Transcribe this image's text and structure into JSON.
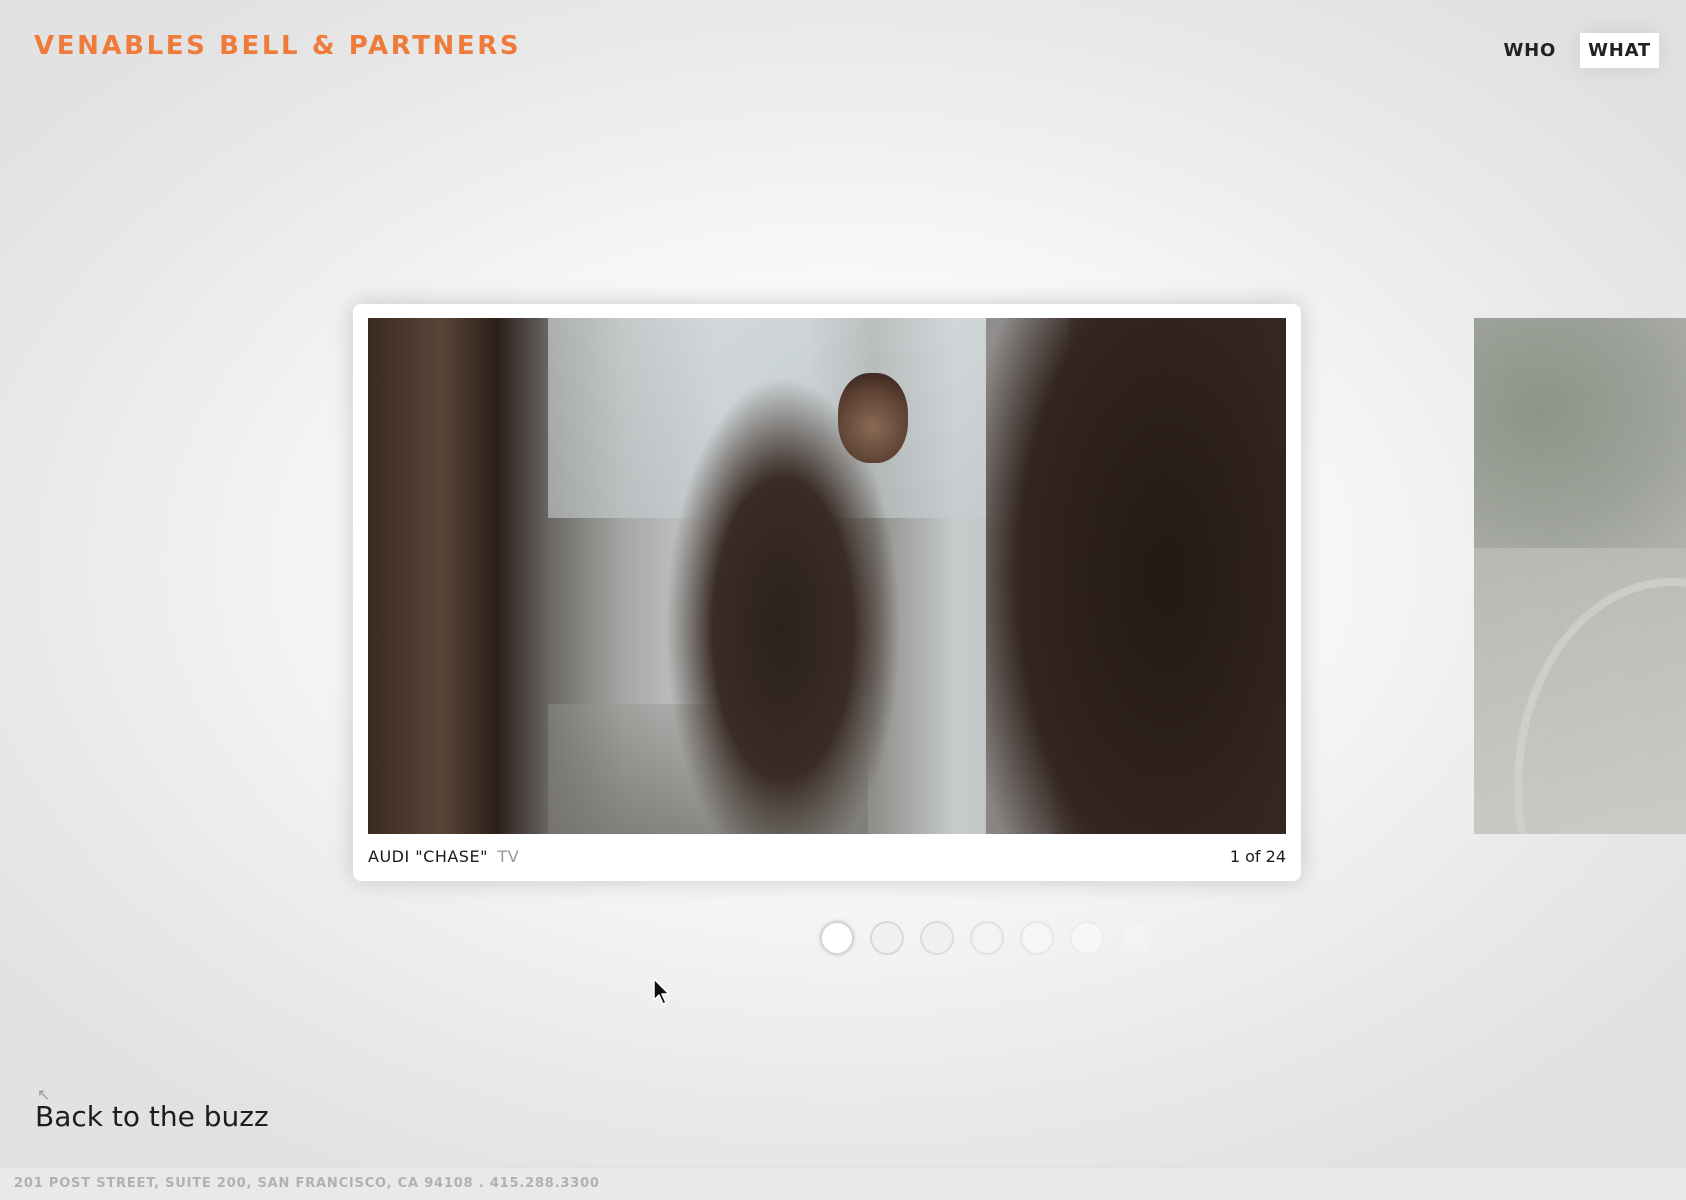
{
  "header": {
    "logo": "VENABLES BELL & PARTNERS",
    "nav": [
      {
        "label": "WHO",
        "active": false
      },
      {
        "label": "WHAT",
        "active": true
      }
    ]
  },
  "slide": {
    "client": "AUDI",
    "title": "\"CHASE\"",
    "type": "TV",
    "counter": "1 of 24"
  },
  "pagination": {
    "current": 1,
    "visible_dots": 7
  },
  "back_link": {
    "arrow": "↖",
    "label": "Back to the buzz"
  },
  "footer": {
    "address": "201 POST STREET, SUITE 200, SAN FRANCISCO, CA 94108 . 415.288.3300"
  },
  "colors": {
    "brand_orange": "#ee7b3a",
    "text_dark": "#1a1a1a",
    "footer_text": "#b1b1b1"
  }
}
